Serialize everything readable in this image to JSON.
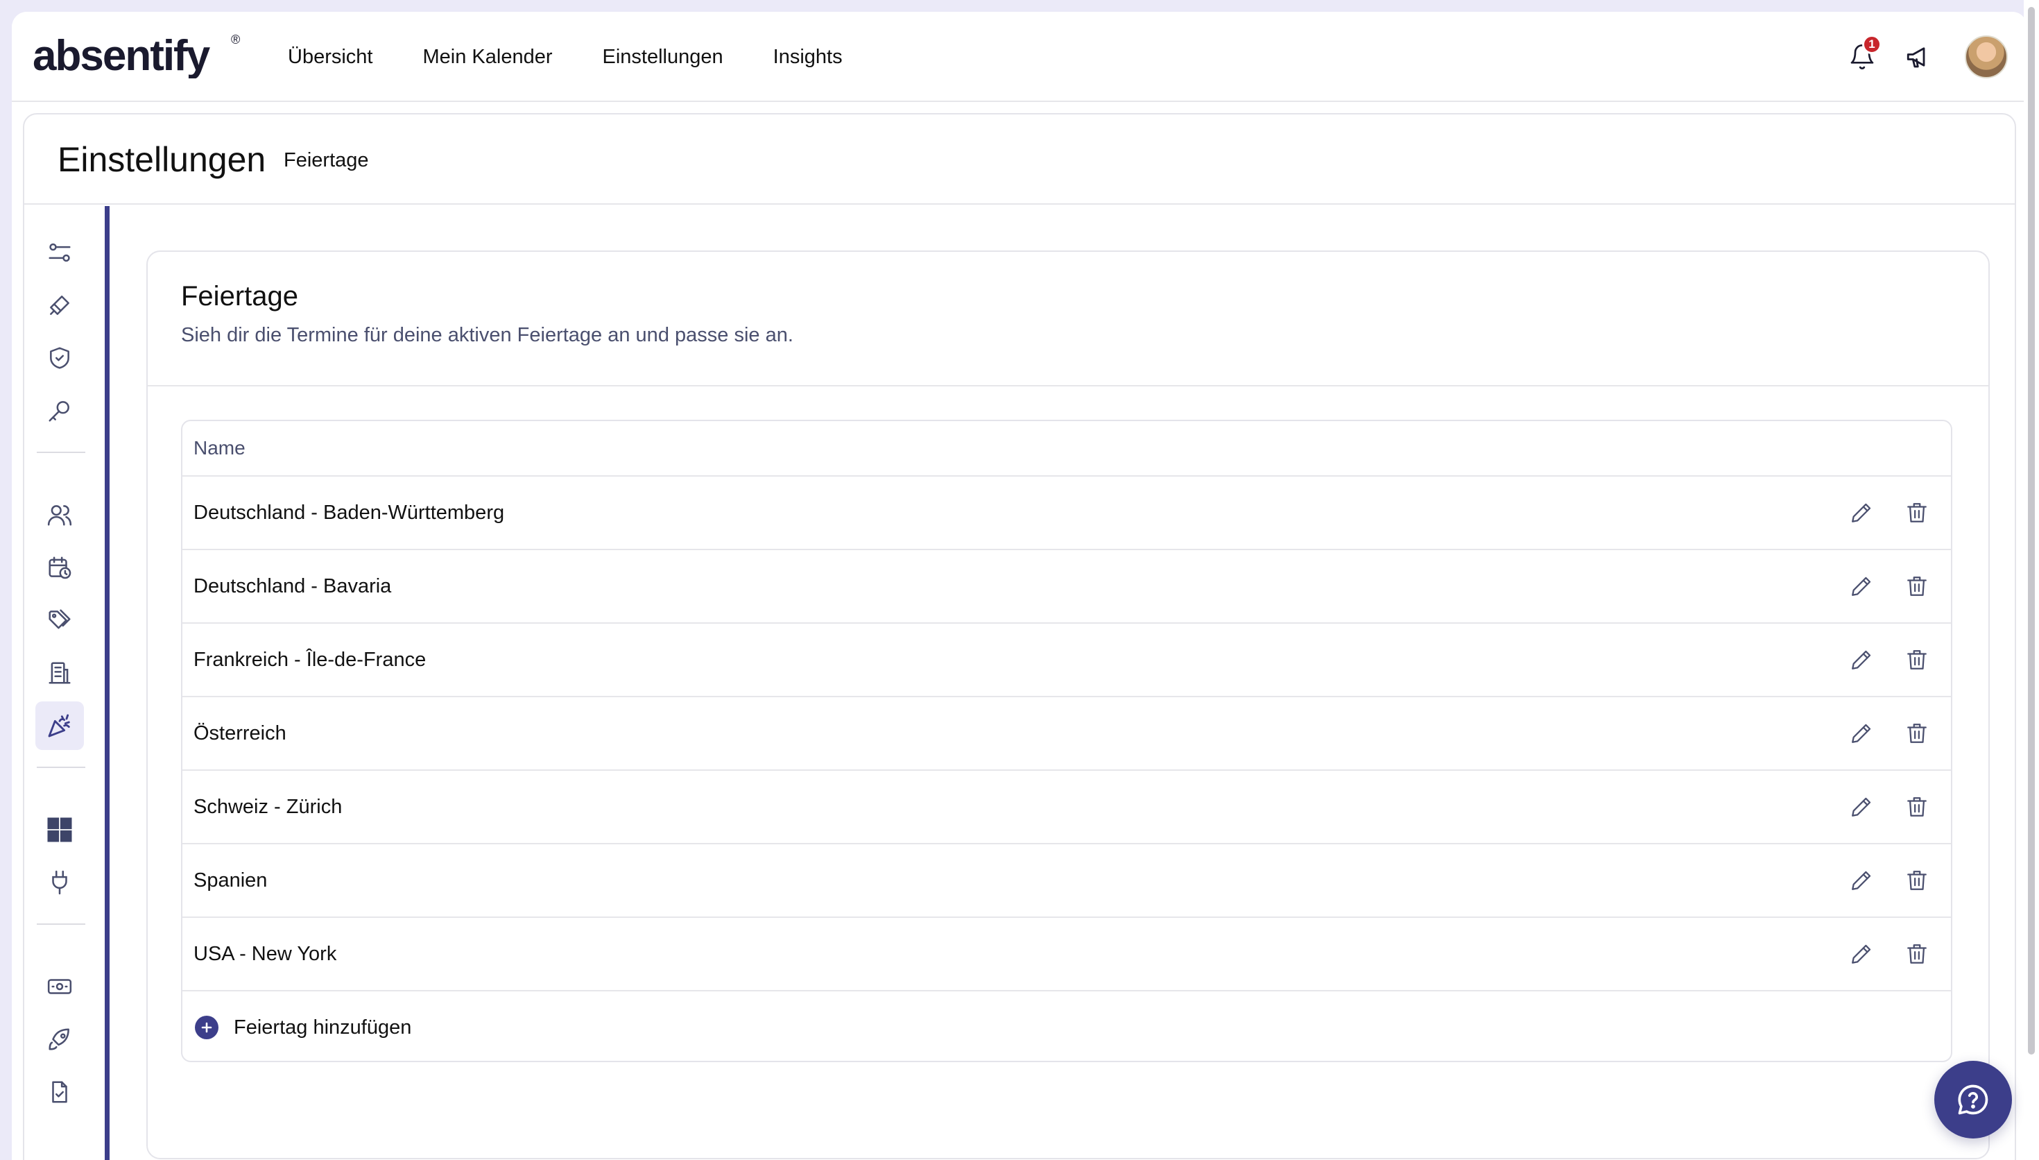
{
  "app": {
    "logo_text": "absentify",
    "registered_mark": "®"
  },
  "nav": {
    "items": [
      "Übersicht",
      "Mein Kalender",
      "Einstellungen",
      "Insights"
    ]
  },
  "topbar": {
    "notification_count": "1"
  },
  "page": {
    "title": "Einstellungen",
    "breadcrumb": "Feiertage"
  },
  "card": {
    "title": "Feiertage",
    "subtitle": "Sieh dir die Termine für deine aktiven Feiertage an und passe sie an."
  },
  "table": {
    "header": "Name",
    "rows": [
      "Deutschland - Baden-Württemberg",
      "Deutschland - Bavaria",
      "Frankreich - Île-de-France",
      "Österreich",
      "Schweiz - Zürich",
      "Spanien",
      "USA - New York"
    ],
    "add_label": "Feiertag hinzufügen"
  },
  "colors": {
    "accent": "#3c3e8a",
    "badge": "#c8262c",
    "active_bg": "#ebeaf8"
  },
  "sidebar_icons": [
    "sliders-icon",
    "brush-icon",
    "shield-icon",
    "key-icon",
    "users-icon",
    "calendar-clock-icon",
    "tags-icon",
    "building-icon",
    "party-icon",
    "windows-icon",
    "plug-icon",
    "money-icon",
    "rocket-icon",
    "file-check-icon"
  ]
}
